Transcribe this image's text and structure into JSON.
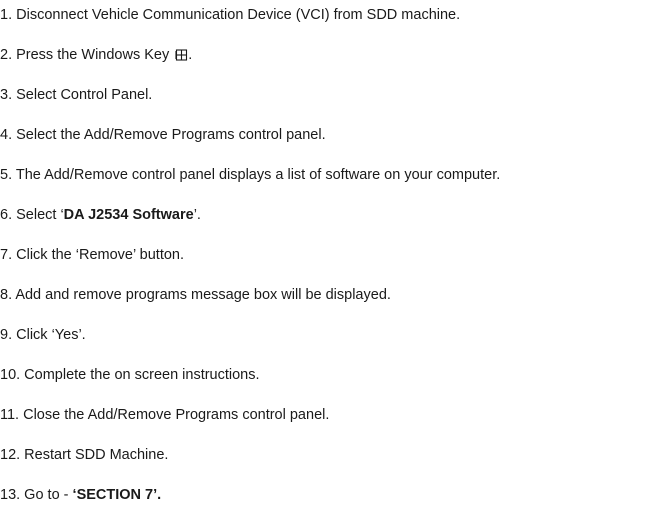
{
  "steps": [
    {
      "text": "1. Disconnect Vehicle Communication Device (VCI) from SDD machine."
    },
    {
      "prefix": "2. Press the Windows Key ",
      "icon": "windows-key-icon",
      "suffix": "."
    },
    {
      "text": "3. Select Control Panel."
    },
    {
      "text": "4. Select the Add/Remove Programs control panel."
    },
    {
      "text": "5. The Add/Remove control panel displays a list of software on your computer."
    },
    {
      "prefix": "6. Select ‘",
      "bold": "DA J2534 Software",
      "suffix": "’."
    },
    {
      "text": "7. Click the ‘Remove’ button."
    },
    {
      "text": "8. Add and remove programs message box will be displayed."
    },
    {
      "text": "9. Click ‘Yes’."
    },
    {
      "text": "10. Complete the on screen instructions."
    },
    {
      "text": "11. Close the Add/Remove Programs control panel."
    },
    {
      "text": "12. Restart SDD Machine."
    },
    {
      "prefix": "13. Go to - ",
      "bold": "‘SECTION 7’."
    }
  ]
}
